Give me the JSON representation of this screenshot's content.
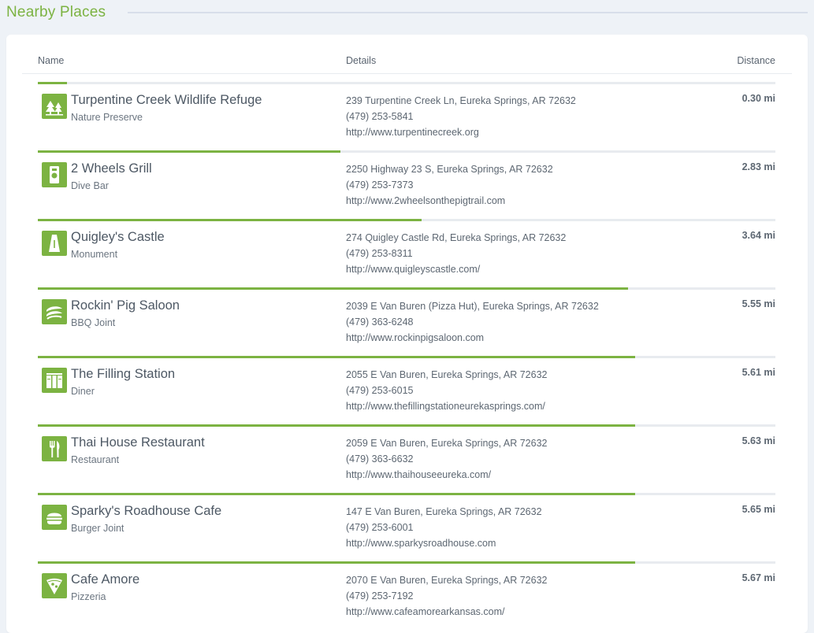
{
  "section": {
    "title": "Nearby Places"
  },
  "table": {
    "headers": {
      "name": "Name",
      "details": "Details",
      "distance": "Distance"
    },
    "accent_color": "#7cb342",
    "rows": [
      {
        "name": "Turpentine Creek Wildlife Refuge",
        "category": "Nature Preserve",
        "address": "239 Turpentine Creek Ln, Eureka Springs, AR 72632",
        "phone": "(479) 253-5841",
        "url": "http://www.turpentinecreek.org",
        "distance": "0.30 mi",
        "icon": "trees-icon",
        "bar_fraction": 0.04
      },
      {
        "name": "2 Wheels Grill",
        "category": "Dive Bar",
        "address": "2250 Highway 23 S, Eureka Springs, AR 72632",
        "phone": "(479) 253-7373",
        "url": "http://www.2wheelsonthepigtrail.com",
        "distance": "2.83 mi",
        "icon": "bar-drink-icon",
        "bar_fraction": 0.41
      },
      {
        "name": "Quigley's Castle",
        "category": "Monument",
        "address": "274 Quigley Castle Rd, Eureka Springs, AR 72632",
        "phone": "(479) 253-8311",
        "url": "http://www.quigleyscastle.com/",
        "distance": "3.64 mi",
        "icon": "monument-icon",
        "bar_fraction": 0.52
      },
      {
        "name": "Rockin' Pig Saloon",
        "category": "BBQ Joint",
        "address": "2039 E Van Buren (Pizza Hut), Eureka Springs, AR 72632",
        "phone": "(479) 363-6248",
        "url": "http://www.rockinpigsaloon.com",
        "distance": "5.55 mi",
        "icon": "bbq-icon",
        "bar_fraction": 0.8
      },
      {
        "name": "The Filling Station",
        "category": "Diner",
        "address": "2055 E Van Buren, Eureka Springs, AR 72632",
        "phone": "(479) 253-6015",
        "url": "http://www.thefillingstationeurekasprings.com/",
        "distance": "5.61 mi",
        "icon": "diner-icon",
        "bar_fraction": 0.81
      },
      {
        "name": "Thai House Restaurant",
        "category": "Restaurant",
        "address": "2059 E Van Buren, Eureka Springs, AR 72632",
        "phone": "(479) 363-6632",
        "url": "http://www.thaihouseeureka.com/",
        "distance": "5.63 mi",
        "icon": "fork-knife-icon",
        "bar_fraction": 0.81
      },
      {
        "name": "Sparky's Roadhouse Cafe",
        "category": "Burger Joint",
        "address": "147 E Van Buren, Eureka Springs, AR 72632",
        "phone": "(479) 253-6001",
        "url": "http://www.sparkysroadhouse.com",
        "distance": "5.65 mi",
        "icon": "burger-icon",
        "bar_fraction": 0.81
      },
      {
        "name": "Cafe Amore",
        "category": "Pizzeria",
        "address": "2070 E Van Buren, Eureka Springs, AR 72632",
        "phone": "(479) 253-7192",
        "url": "http://www.cafeamorearkansas.com/",
        "distance": "5.67 mi",
        "icon": "pizza-icon",
        "bar_fraction": 0.81
      }
    ]
  }
}
